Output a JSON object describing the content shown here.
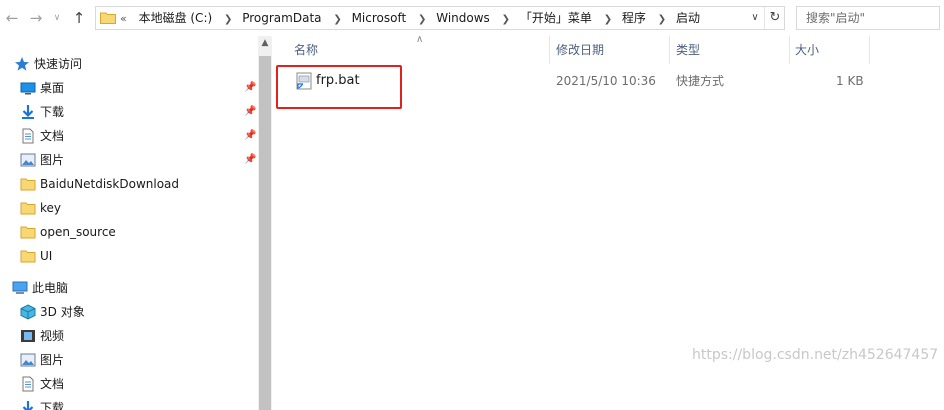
{
  "address": {
    "breadcrumbs": [
      "本地磁盘 (C:)",
      "ProgramData",
      "Microsoft",
      "Windows",
      "「开始」菜单",
      "程序",
      "启动"
    ],
    "overflow_glyph": "«"
  },
  "search": {
    "placeholder": "搜索\"启动\""
  },
  "sidebar": {
    "quick_access": "快速访问",
    "pinned": [
      {
        "label": "桌面",
        "icon": "desktop-icon"
      },
      {
        "label": "下载",
        "icon": "download-icon"
      },
      {
        "label": "文档",
        "icon": "document-icon"
      },
      {
        "label": "图片",
        "icon": "picture-icon"
      }
    ],
    "folders": [
      {
        "label": "BaiduNetdiskDownload"
      },
      {
        "label": "key"
      },
      {
        "label": "open_source"
      },
      {
        "label": "UI"
      }
    ],
    "this_pc": "此电脑",
    "pc_items": [
      {
        "label": "3D 对象",
        "icon": "3d-objects-icon"
      },
      {
        "label": "视频",
        "icon": "video-icon"
      },
      {
        "label": "图片",
        "icon": "picture-icon"
      },
      {
        "label": "文档",
        "icon": "document-icon"
      },
      {
        "label": "下载",
        "icon": "download-icon"
      }
    ]
  },
  "columns": {
    "name": "名称",
    "modified": "修改日期",
    "type": "类型",
    "size": "大小"
  },
  "files": [
    {
      "name": "frp.bat",
      "modified": "2021/5/10 10:36",
      "type": "快捷方式",
      "size": "1 KB"
    }
  ],
  "watermark": "https://blog.csdn.net/zh452647457",
  "colors": {
    "highlight_border": "#e0211c",
    "folder_yellow": "#f8d775",
    "header_text": "#4d6082"
  }
}
